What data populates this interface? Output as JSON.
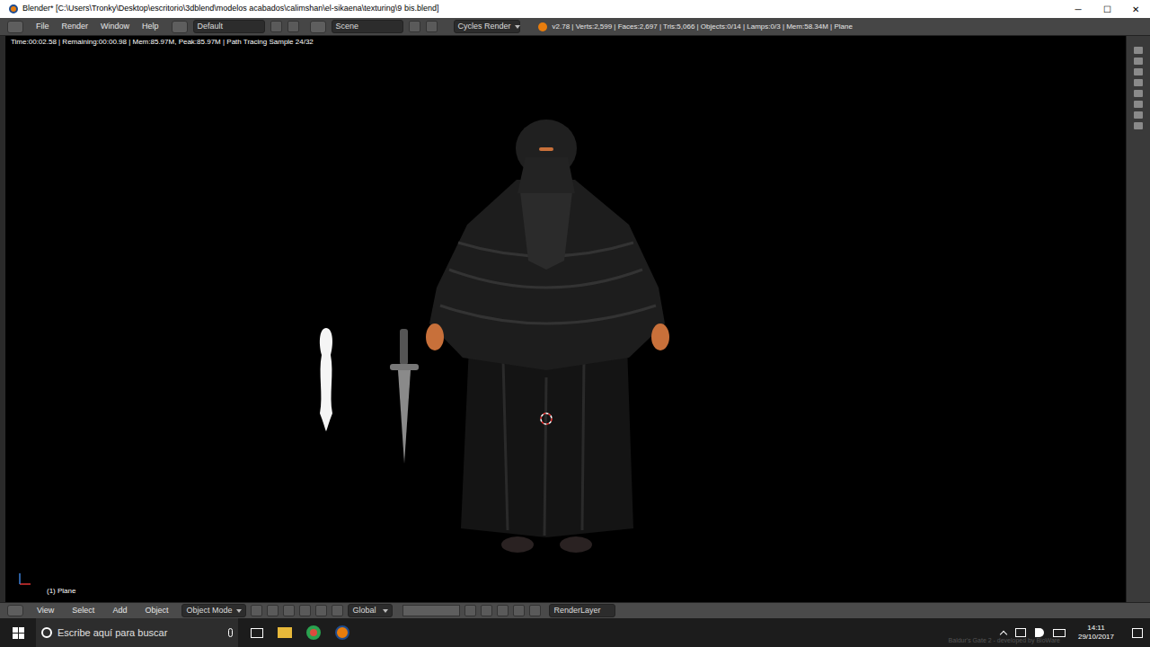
{
  "window": {
    "title": "Blender* [C:\\Users\\Tronky\\Desktop\\escritorio\\3dblend\\modelos acabados\\calimshan\\el-sikaena\\texturing\\9 bis.blend]",
    "controls": [
      "─",
      "☐",
      "✕"
    ]
  },
  "info_header": {
    "menus": [
      "File",
      "Render",
      "Window",
      "Help"
    ],
    "layout": "Default",
    "scene": "Scene",
    "engine": "Cycles Render",
    "stats": "v2.78 | Verts:2,599 | Faces:2,697 | Tris:5,066 | Objects:0/14 | Lamps:0/3 | Mem:58.34M | Plane"
  },
  "viewport": {
    "render_status": "Time:00:02.58 | Remaining:00:00.98 | Mem:85.97M, Peak:85.97M | Path Tracing Sample 24/32",
    "object_label": "(1) Plane"
  },
  "view3d_header": {
    "menus": [
      "View",
      "Select",
      "Add",
      "Object"
    ],
    "mode": "Object Mode",
    "orientation": "Global",
    "render_layer": "RenderLayer"
  },
  "taskbar": {
    "search_placeholder": "Escribe aquí para buscar",
    "time": "14:11",
    "date": "29/10/2017",
    "watermark": "Baldur's Gate 2 - developed by BioWare"
  }
}
